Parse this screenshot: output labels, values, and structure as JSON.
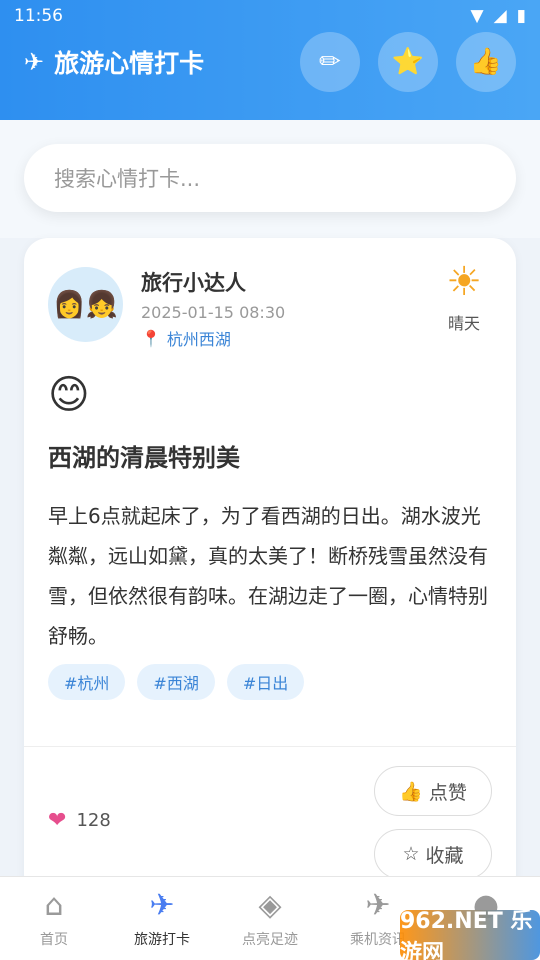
{
  "status_bar": {
    "time": "11:56",
    "wifi_icon": "wifi-icon",
    "signal_icon": "signal-icon",
    "battery_icon": "battery-icon"
  },
  "header": {
    "title": "旅游心情打卡",
    "title_icon": "airplane-icon",
    "actions": [
      {
        "name": "edit-button",
        "icon": "pencil-icon",
        "glyph": "✏"
      },
      {
        "name": "favorites-button",
        "icon": "star-icon",
        "glyph": "⭐"
      },
      {
        "name": "like-button",
        "icon": "thumbs-up-icon",
        "glyph": "👍"
      }
    ]
  },
  "search": {
    "placeholder": "搜索心情打卡..."
  },
  "post": {
    "avatar": "👩👧",
    "user_name": "旅行小达人",
    "time": "2025-01-15 08:30",
    "location": "杭州西湖",
    "weather": {
      "icon": "sun-icon",
      "glyph": "☀",
      "label": "晴天"
    },
    "mood": "😊",
    "title": "西湖的清晨特别美",
    "content": "早上6点就起床了，为了看西湖的日出。湖水波光粼粼，远山如黛，真的太美了！断桥残雪虽然没有雪，但依然很有韵味。在湖边走了一圈，心情特别舒畅。",
    "tags": [
      "#杭州",
      "#西湖",
      "#日出"
    ],
    "likes": "128",
    "like_button": "点赞",
    "favorite_button": "收藏"
  },
  "tabs": [
    {
      "label": "首页",
      "icon": "home-icon",
      "glyph": "⌂",
      "active": false
    },
    {
      "label": "旅游打卡",
      "icon": "airplane-icon",
      "glyph": "✈",
      "active": true
    },
    {
      "label": "点亮足迹",
      "icon": "layers-icon",
      "glyph": "◈",
      "active": false
    },
    {
      "label": "乘机资讯",
      "icon": "plane-icon",
      "glyph": "✈",
      "active": false
    },
    {
      "label": "",
      "icon": "profile-icon",
      "glyph": "●",
      "active": false
    }
  ],
  "watermark": "962.NET 乐游网"
}
